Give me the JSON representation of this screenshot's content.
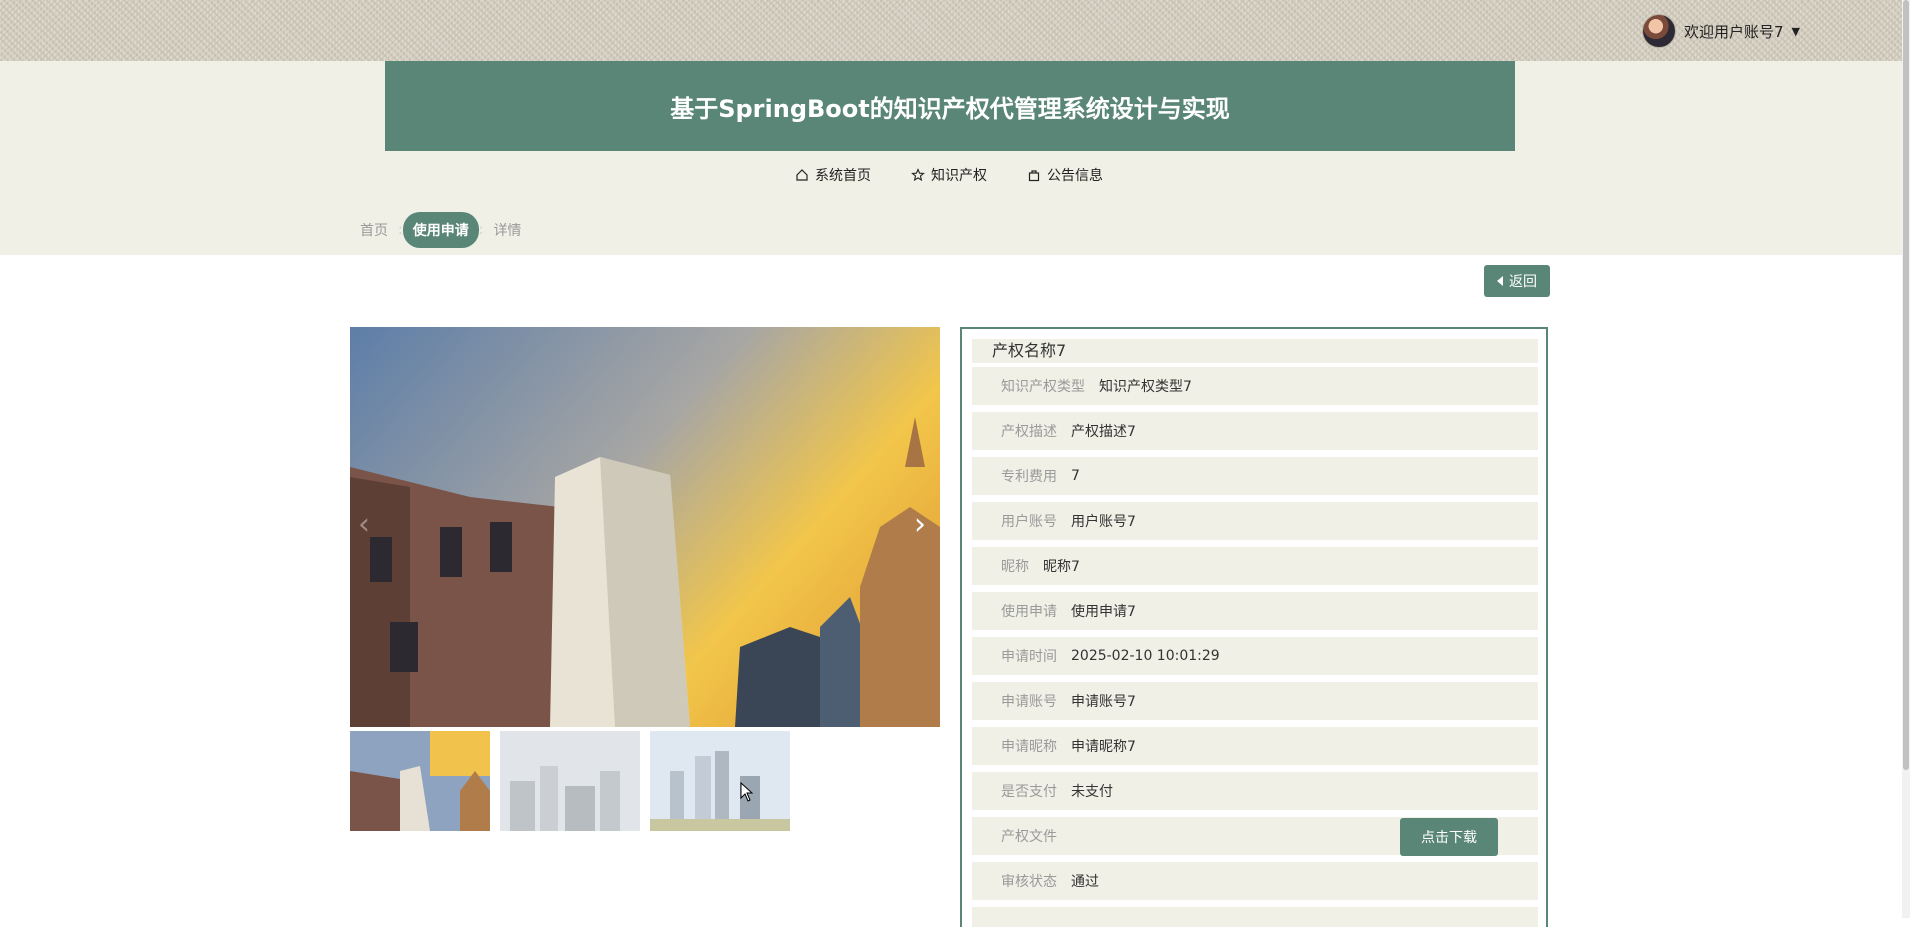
{
  "header": {
    "user_name": "欢迎用户账号7",
    "site_title": "基于SpringBoot的知识产权代管理系统设计与实现"
  },
  "nav": {
    "items": [
      {
        "label": "系统首页",
        "icon": "home-icon"
      },
      {
        "label": "知识产权",
        "icon": "star-icon"
      },
      {
        "label": "公告信息",
        "icon": "bag-icon"
      }
    ]
  },
  "breadcrumb": [
    "首页",
    "使用申请",
    "详情"
  ],
  "back_label": "返回",
  "detail": {
    "title": "产权名称7",
    "rows": [
      {
        "label": "知识产权类型",
        "value": "知识产权类型7"
      },
      {
        "label": "产权描述",
        "value": "产权描述7"
      },
      {
        "label": "专利费用",
        "value": "7"
      },
      {
        "label": "用户账号",
        "value": "用户账号7"
      },
      {
        "label": "昵称",
        "value": "昵称7"
      },
      {
        "label": "使用申请",
        "value": "使用申请7"
      },
      {
        "label": "申请时间",
        "value": "2025-02-10 10:01:29"
      },
      {
        "label": "申请账号",
        "value": "申请账号7"
      },
      {
        "label": "申请昵称",
        "value": "申请昵称7"
      },
      {
        "label": "是否支付",
        "value": "未支付"
      },
      {
        "label": "产权文件",
        "value": "",
        "button": "点击下载"
      },
      {
        "label": "审核状态",
        "value": "通过"
      }
    ]
  },
  "colors": {
    "accent": "#5a8678",
    "band": "#f0f0e6"
  }
}
